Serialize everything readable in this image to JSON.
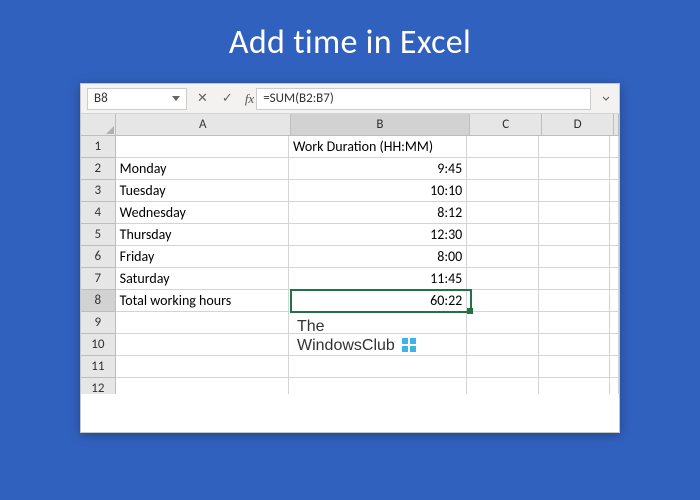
{
  "page_title": "Add time in Excel",
  "namebox": {
    "value": "B8"
  },
  "formula_bar": {
    "fx_label": "fx",
    "formula": "=SUM(B2:B7)"
  },
  "columns": [
    "A",
    "B",
    "C",
    "D"
  ],
  "rows": [
    {
      "num": "1",
      "A": "",
      "B": "Work Duration (HH:MM)",
      "C": "",
      "D": ""
    },
    {
      "num": "2",
      "A": "Monday",
      "B": "9:45",
      "C": "",
      "D": ""
    },
    {
      "num": "3",
      "A": "Tuesday",
      "B": "10:10",
      "C": "",
      "D": ""
    },
    {
      "num": "4",
      "A": "Wednesday",
      "B": "8:12",
      "C": "",
      "D": ""
    },
    {
      "num": "5",
      "A": "Thursday",
      "B": "12:30",
      "C": "",
      "D": ""
    },
    {
      "num": "6",
      "A": "Friday",
      "B": "8:00",
      "C": "",
      "D": ""
    },
    {
      "num": "7",
      "A": "Saturday",
      "B": "11:45",
      "C": "",
      "D": ""
    },
    {
      "num": "8",
      "A": "Total working hours",
      "B": "60:22",
      "C": "",
      "D": ""
    },
    {
      "num": "9",
      "A": "",
      "B": "",
      "C": "",
      "D": ""
    },
    {
      "num": "10",
      "A": "",
      "B": "",
      "C": "",
      "D": ""
    },
    {
      "num": "11",
      "A": "",
      "B": "",
      "C": "",
      "D": ""
    },
    {
      "num": "12",
      "A": "",
      "B": "",
      "C": "",
      "D": ""
    }
  ],
  "selected_cell": {
    "row": 8,
    "col": "B"
  },
  "watermark": {
    "line1": "The",
    "line2": "WindowsClub"
  }
}
